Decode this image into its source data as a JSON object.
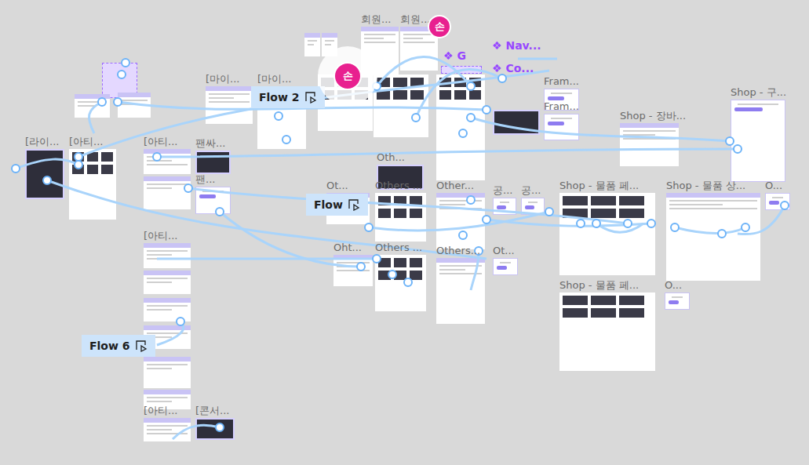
{
  "canvas": {
    "frames": [
      {
        "label": "회원...",
        "kind": "page"
      },
      {
        "label": "회원...",
        "kind": "page"
      },
      {
        "label": "[마이...",
        "kind": "page"
      },
      {
        "label": "[마이...",
        "kind": "page"
      },
      {
        "label": "[라이...",
        "kind": "photo"
      },
      {
        "label": "[아티...",
        "kind": "grid"
      },
      {
        "label": "[아티...",
        "kind": "page"
      },
      {
        "label": "팬싸...",
        "kind": "photo"
      },
      {
        "label": "팬...",
        "kind": "form"
      },
      {
        "label": "[아티...",
        "kind": "page"
      },
      {
        "label": "[아티...",
        "kind": "page"
      },
      {
        "label": "[콘서...",
        "kind": "photo"
      },
      {
        "label": "Oth...",
        "kind": "photo"
      },
      {
        "label": "Ot...",
        "kind": "page"
      },
      {
        "label": "Others ...",
        "kind": "grid"
      },
      {
        "label": "Other...",
        "kind": "page"
      },
      {
        "label": "공...",
        "kind": "form"
      },
      {
        "label": "공...",
        "kind": "form"
      },
      {
        "label": "Oht...",
        "kind": "page"
      },
      {
        "label": "Others ...",
        "kind": "grid"
      },
      {
        "label": "Others...",
        "kind": "page"
      },
      {
        "label": "Ot...",
        "kind": "form"
      },
      {
        "label": "Fram...",
        "kind": "form"
      },
      {
        "label": "Fram...",
        "kind": "form"
      },
      {
        "label": "Shop - 장바...",
        "kind": "page"
      },
      {
        "label": "Shop - 구...",
        "kind": "form"
      },
      {
        "label": "Shop - 물품 페...",
        "kind": "grid"
      },
      {
        "label": "Shop - 물품 상...",
        "kind": "page"
      },
      {
        "label": "O...",
        "kind": "form"
      },
      {
        "label": "Shop - 물품 페...",
        "kind": "grid"
      },
      {
        "label": "O...",
        "kind": "form"
      }
    ],
    "components": [
      {
        "icon": "❖",
        "label": "Nav..."
      },
      {
        "icon": "❖",
        "label": "Co..."
      },
      {
        "icon": "❖",
        "label": "G"
      }
    ],
    "flows": [
      {
        "label": "Flow 2"
      },
      {
        "label": "Flow"
      },
      {
        "label": "Flow 6"
      }
    ],
    "avatars": [
      {
        "initial": "손",
        "color": "#e8208f"
      },
      {
        "initial": "손",
        "color": "#e8208f"
      }
    ]
  }
}
